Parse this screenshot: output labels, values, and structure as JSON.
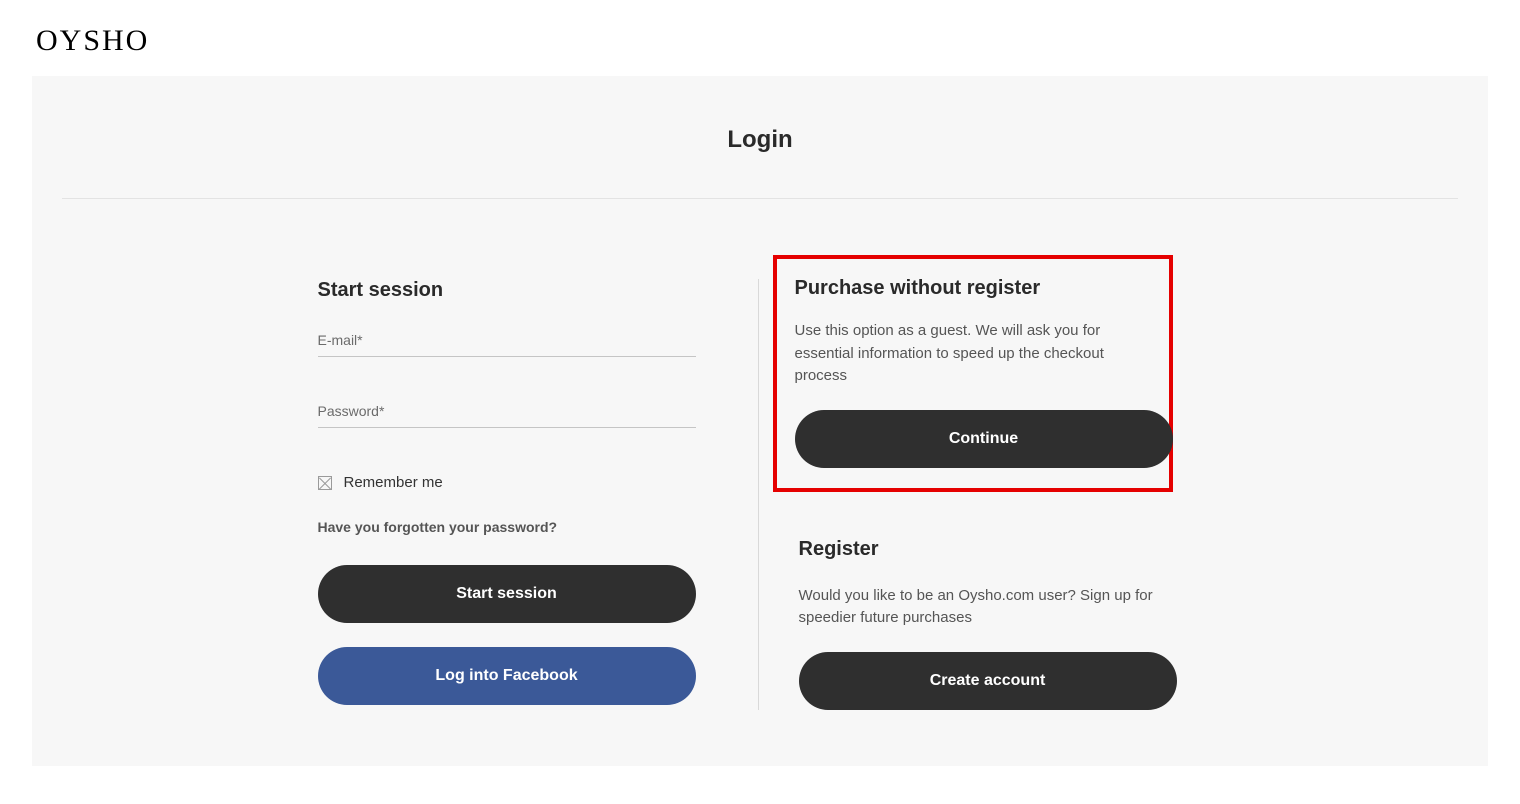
{
  "header": {
    "logo": "OYSHO"
  },
  "page": {
    "title": "Login"
  },
  "left": {
    "title": "Start session",
    "emailLabel": "E-mail*",
    "passwordLabel": "Password*",
    "rememberLabel": "Remember me",
    "forgotLabel": "Have you forgotten your password?",
    "startButton": "Start session",
    "facebookButton": "Log into Facebook"
  },
  "right": {
    "guest": {
      "title": "Purchase without register",
      "desc": "Use this option as a guest. We will ask you for essential information to speed up the checkout process",
      "button": "Continue"
    },
    "register": {
      "title": "Register",
      "desc": "Would you like to be an Oysho.com user? Sign up for speedier future purchases",
      "button": "Create account"
    }
  }
}
